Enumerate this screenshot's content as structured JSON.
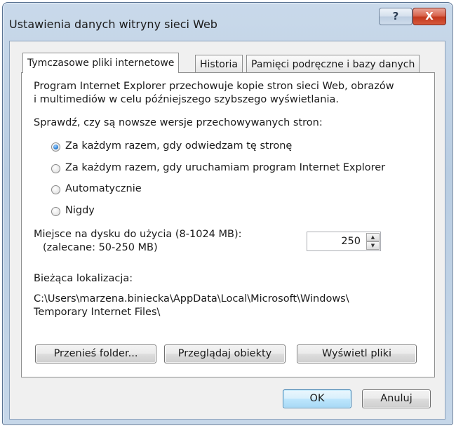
{
  "window": {
    "title": "Ustawienia danych witryny sieci Web",
    "help_label": "?",
    "close_label": "X"
  },
  "tabs": [
    {
      "label": "Tymczasowe pliki internetowe",
      "active": true
    },
    {
      "label": "Historia",
      "active": false
    },
    {
      "label": "Pamięci podręczne i bazy danych",
      "active": false
    }
  ],
  "panel": {
    "description_line1": "Program Internet Explorer przechowuje kopie stron sieci Web, obrazów",
    "description_line2": "i multimediów w celu późniejszego szybszego wyświetlania.",
    "check_label": "Sprawdź, czy są nowsze wersje przechowywanych stron:",
    "radio_options": [
      {
        "label": "Za każdym razem, gdy odwiedzam tę stronę",
        "checked": true
      },
      {
        "label": "Za każdym razem, gdy uruchamiam program Internet Explorer",
        "checked": false
      },
      {
        "label": "Automatycznie",
        "checked": false
      },
      {
        "label": "Nigdy",
        "checked": false
      }
    ],
    "disk_label_line1": "Miejsce na dysku do użycia (8-1024 MB):",
    "disk_label_line2": "(zalecane: 50-250 MB)",
    "disk_value": "250",
    "location_label": "Bieżąca lokalizacja:",
    "location_path_line1": "C:\\Users\\marzena.biniecka\\AppData\\Local\\Microsoft\\Windows\\",
    "location_path_line2": "Temporary Internet Files\\",
    "buttons": {
      "move_folder": "Przenieś folder...",
      "view_objects": "Przeglądaj obiekty",
      "view_files": "Wyświetl pliki"
    }
  },
  "footer": {
    "ok_label": "OK",
    "cancel_label": "Anuluj"
  },
  "icons": {
    "spin_up": "triangle-up",
    "spin_down": "triangle-down"
  }
}
